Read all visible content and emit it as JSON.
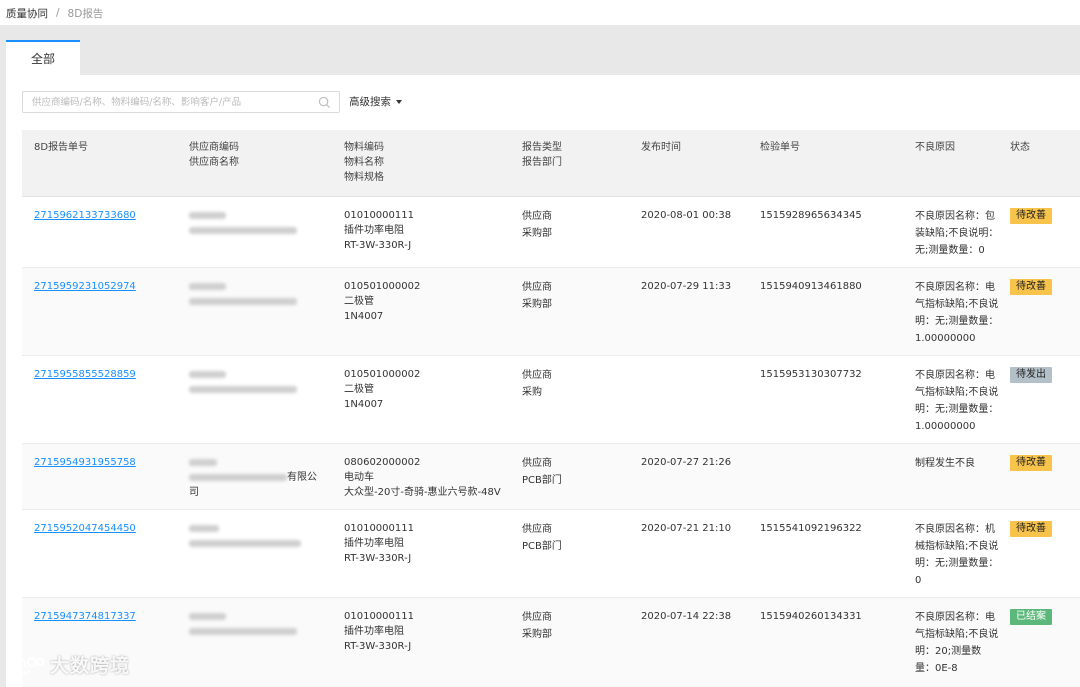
{
  "breadcrumb": {
    "root": "质量协同",
    "separator": "/",
    "current": "8D报告"
  },
  "tabs": [
    {
      "label": "全部",
      "active": true
    }
  ],
  "search": {
    "placeholder": "供应商编码/名称、物料编码/名称、影响客户/产品",
    "value": ""
  },
  "advanced_search": {
    "label": "高级搜索"
  },
  "table": {
    "headers": {
      "report_no": "8D报告单号",
      "supplier": [
        "供应商编码",
        "供应商名称"
      ],
      "material": [
        "物料编码",
        "物料名称",
        "物料规格"
      ],
      "report_type": [
        "报告类型",
        "报告部门"
      ],
      "publish_time": "发布时间",
      "inspection_no": "检验单号",
      "defect_reason": "不良原因",
      "status": "状态"
    },
    "rows": [
      {
        "report_no": "2715962133733680",
        "supplier_name_suffix": "",
        "material_code": "01010000111",
        "material_name": "插件功率电阻",
        "material_spec": "RT-3W-330R-J",
        "report_type": "供应商",
        "department": "采购部",
        "publish_time": "2020-08-01 00:38",
        "inspection_no": "1515928965634345",
        "defect_reason": "不良原因名称：包装缺陷;不良说明：无;测量数量：0",
        "status": "待改善"
      },
      {
        "report_no": "2715959231052974",
        "supplier_name_suffix": "",
        "material_code": "010501000002",
        "material_name": "二极管",
        "material_spec": "1N4007",
        "report_type": "供应商",
        "department": "采购部",
        "publish_time": "2020-07-29 11:33",
        "inspection_no": "1515940913461880",
        "defect_reason": "不良原因名称：电气指标缺陷;不良说明：无;测量数量：1.00000000",
        "status": "待改善"
      },
      {
        "report_no": "2715955855528859",
        "supplier_name_suffix": "",
        "material_code": "010501000002",
        "material_name": "二极管",
        "material_spec": "1N4007",
        "report_type": "供应商",
        "department": "采购",
        "publish_time": "",
        "inspection_no": "1515953130307732",
        "defect_reason": "不良原因名称：电气指标缺陷;不良说明：无;测量数量：1.00000000",
        "status": "待发出"
      },
      {
        "report_no": "2715954931955758",
        "supplier_name_suffix": "有限公",
        "supplier_name_tail": "司",
        "material_code": "080602000002",
        "material_name": "电动车",
        "material_spec": "大众型-20寸-奇骑-惠业六号款-48V",
        "report_type": "供应商",
        "department": "PCB部门",
        "publish_time": "2020-07-27 21:26",
        "inspection_no": "",
        "defect_reason": "制程发生不良",
        "status": "待改善"
      },
      {
        "report_no": "2715952047454450",
        "supplier_name_suffix": "",
        "material_code": "01010000111",
        "material_name": "插件功率电阻",
        "material_spec": "RT-3W-330R-J",
        "report_type": "供应商",
        "department": "PCB部门",
        "publish_time": "2020-07-21 21:10",
        "inspection_no": "1515541092196322",
        "defect_reason": "不良原因名称：机械指标缺陷;不良说明：无;测量数量：0",
        "status": "待改善"
      },
      {
        "report_no": "2715947374817337",
        "supplier_name_suffix": "",
        "material_code": "01010000111",
        "material_name": "插件功率电阻",
        "material_spec": "RT-3W-330R-J",
        "report_type": "供应商",
        "department": "采购部",
        "publish_time": "2020-07-14 22:38",
        "inspection_no": "1515940260134331",
        "defect_reason": "不良原因名称：电气指标缺陷;不良说明：20;测量数量：0E-8",
        "status": "已结案"
      }
    ]
  },
  "status_colors": {
    "待改善": "#f7c34a",
    "待发出": "#b3c0c8",
    "已结案": "#5cb87a"
  },
  "watermark": {
    "text": "大数跨境"
  }
}
